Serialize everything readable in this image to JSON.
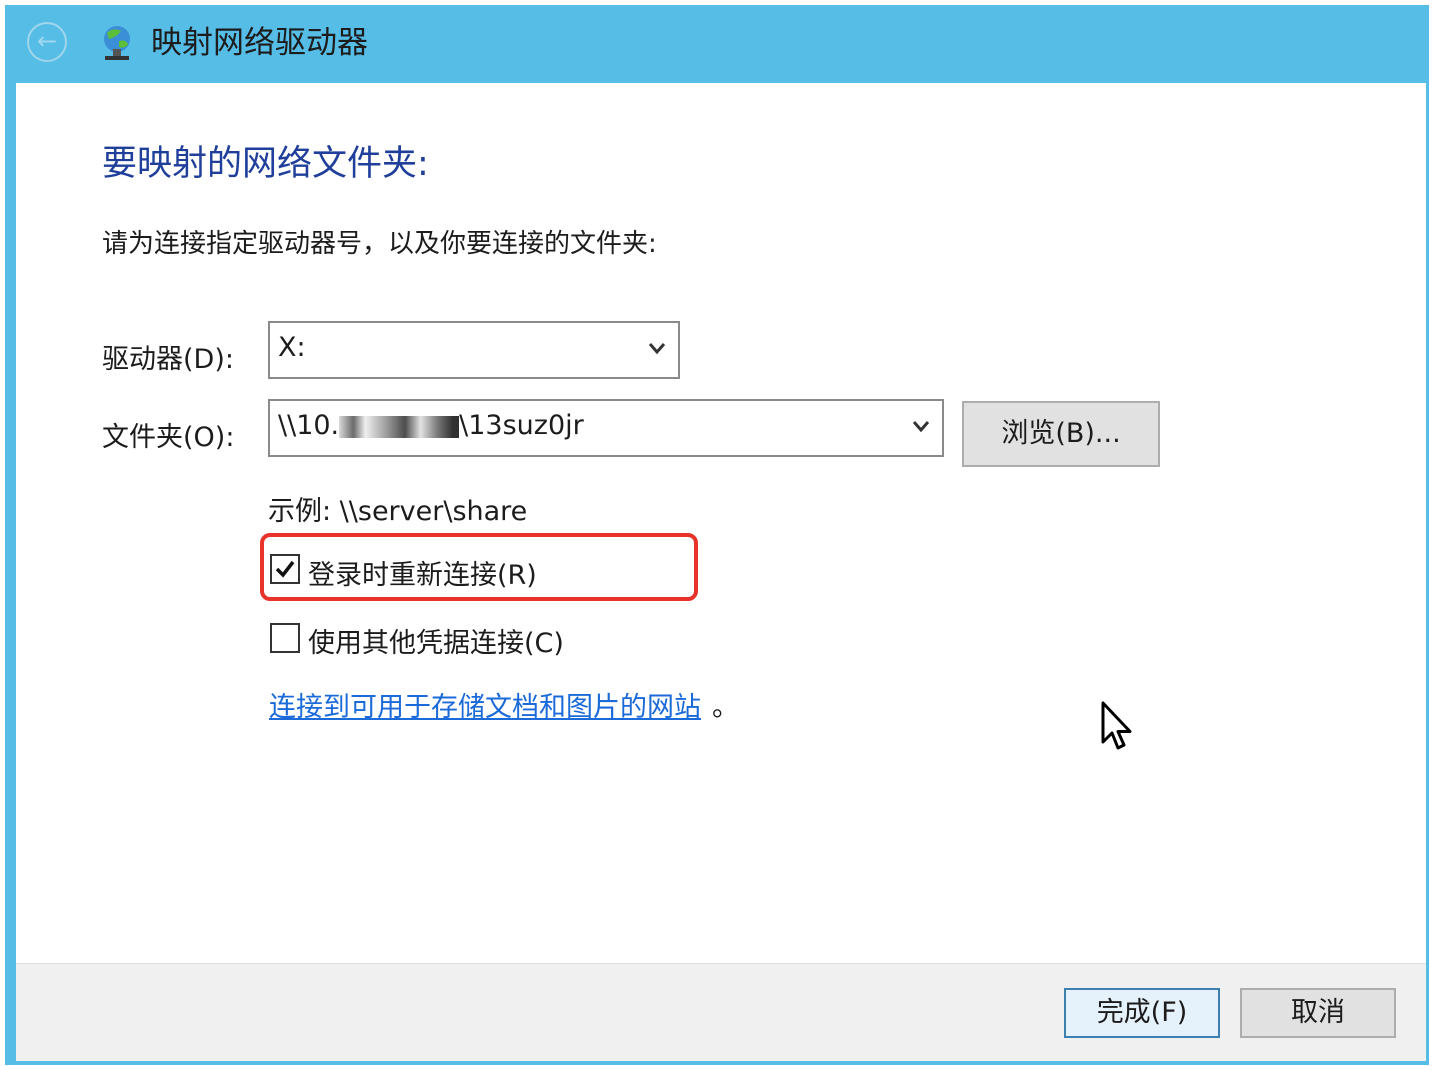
{
  "window": {
    "title": "映射网络驱动器",
    "back_icon": "back-arrow-icon",
    "app_icon": "network-drive-icon",
    "accent_color": "#56bde6"
  },
  "main": {
    "heading": "要映射的网络文件夹:",
    "instruction": "请为连接指定驱动器号，以及你要连接的文件夹:",
    "drive": {
      "label": "驱动器(D):",
      "value": "X:"
    },
    "folder": {
      "label": "文件夹(O):",
      "value_prefix": "\\\\10.",
      "value_suffix": "\\13suz0jr"
    },
    "browse_label": "浏览(B)...",
    "example": "示例: \\\\server\\share",
    "reconnect": {
      "label": "登录时重新连接(R)",
      "checked": true
    },
    "other_credentials": {
      "label": "使用其他凭据连接(C)",
      "checked": false
    },
    "link_text": "连接到可用于存储文档和图片的网站",
    "link_period": "。"
  },
  "footer": {
    "finish_label": "完成(F)",
    "cancel_label": "取消"
  }
}
